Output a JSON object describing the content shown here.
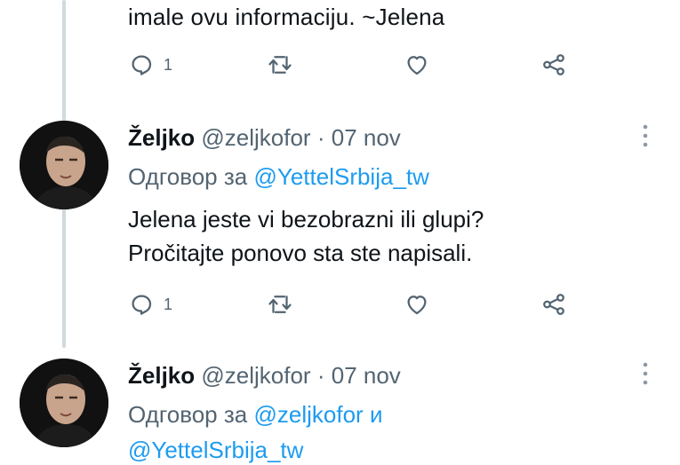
{
  "top_tweet": {
    "text": "imale ovu informaciju. ~Jelena",
    "reply_count": "1"
  },
  "tweets": [
    {
      "author_name": "Željko",
      "author_handle": "@zeljkofor",
      "separator": "·",
      "date": "07 nov",
      "replying_prefix": "Одговор за",
      "replying_mention_1": "@YettelSrbija_tw",
      "replying_join": "",
      "replying_mention_2": "",
      "line_1": "Jelena jeste vi bezobrazni ili glupi?",
      "line_2": "Pročitajte ponovo sta ste napisali.",
      "reply_count": "1"
    },
    {
      "author_name": "Željko",
      "author_handle": "@zeljkofor",
      "separator": "·",
      "date": "07 nov",
      "replying_prefix": "Одговор за",
      "replying_mention_1": "@zeljkofor",
      "replying_join": "и",
      "replying_mention_2": "@YettelSrbija_tw"
    }
  ],
  "icons": {
    "reply": "reply-icon",
    "retweet": "retweet-icon",
    "like": "heart-icon",
    "share": "share-icon",
    "more": "more-options-icon"
  },
  "colors": {
    "text": "#0f1419",
    "secondary": "#536471",
    "mention": "#1d9bf0",
    "thread_line": "#cfd9de"
  }
}
